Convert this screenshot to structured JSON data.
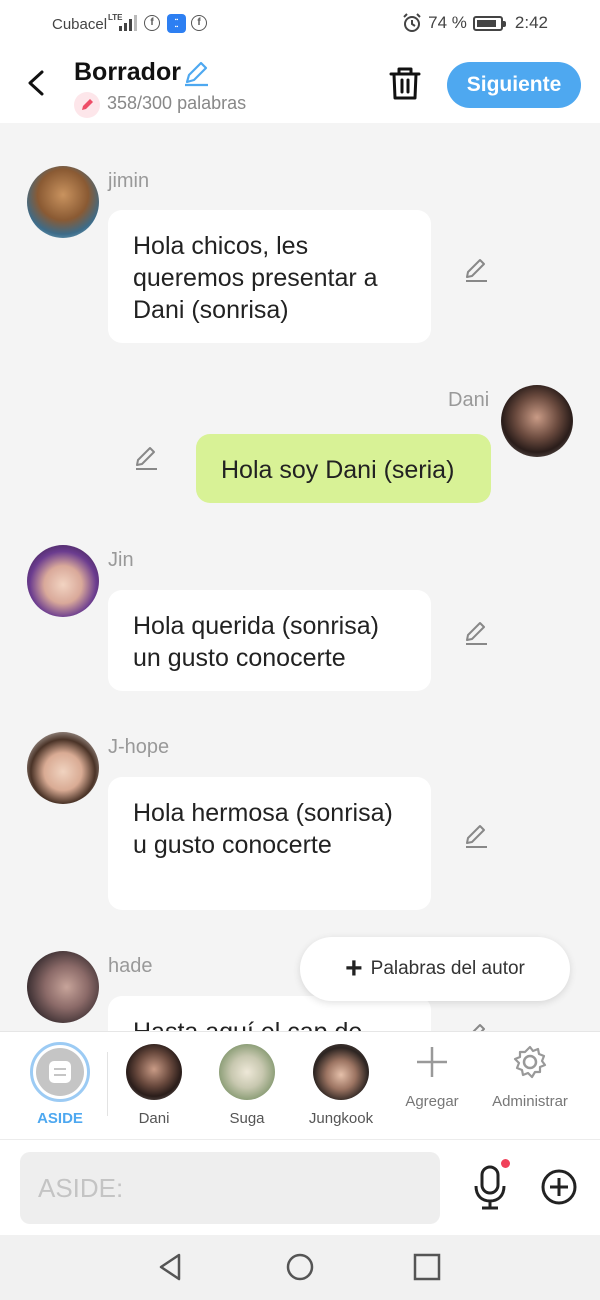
{
  "status": {
    "carrier": "Cubacel",
    "network": "LTE",
    "battery": "74 %",
    "time": "2:42"
  },
  "header": {
    "title": "Borrador",
    "word_count": "358/300 palabras",
    "next_label": "Siguiente"
  },
  "messages": [
    {
      "name": "jimin",
      "text": "Hola chicos, les queremos presentar a Dani (sonrisa)"
    },
    {
      "name": "Dani",
      "text": "Hola soy Dani (seria)"
    },
    {
      "name": "Jin",
      "text": "Hola querida (sonrisa) un gusto conocerte"
    },
    {
      "name": "J-hope",
      "text": "Hola hermosa (sonrisa) u gusto conocerte"
    },
    {
      "name": "hade",
      "text": "Hasta aquí el cap de"
    }
  ],
  "author_words_label": "Palabras del autor",
  "roles": [
    {
      "label": "ASIDE"
    },
    {
      "label": "Dani"
    },
    {
      "label": "Suga"
    },
    {
      "label": "Jungkook"
    }
  ],
  "tools": {
    "add_label": "Agregar",
    "manage_label": "Administrar"
  },
  "input": {
    "placeholder": "ASIDE:"
  },
  "colors": {
    "accent": "#4ea8f0",
    "own_bubble": "#d8f296",
    "background": "#f4f4f4"
  }
}
